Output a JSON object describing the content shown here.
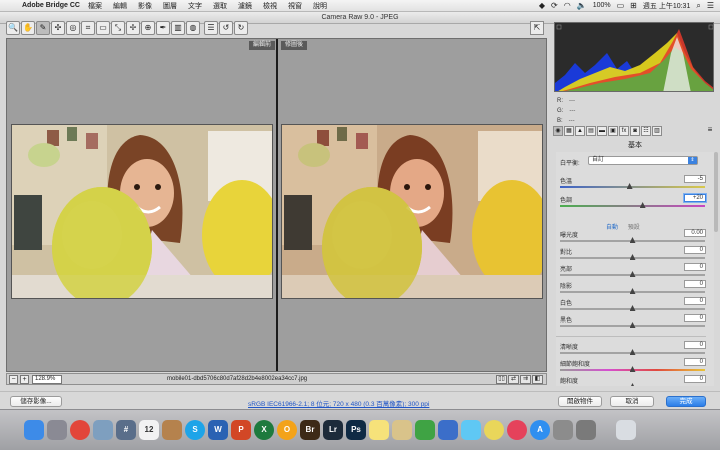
{
  "menubar": {
    "app_name": "Adobe Bridge CC",
    "items": [
      "檔案",
      "編輯",
      "影像",
      "圖層",
      "文字",
      "選取",
      "濾鏡",
      "檢視",
      "視窗",
      "說明"
    ],
    "battery": "100%",
    "clock": "週五 上午10:31"
  },
  "window": {
    "title": "Camera Raw 9.0  -  JPEG"
  },
  "toolbar": {
    "tools": [
      {
        "name": "zoom-tool",
        "glyph": "🔍"
      },
      {
        "name": "hand-tool",
        "glyph": "✋"
      },
      {
        "name": "white-balance-tool",
        "glyph": "✎"
      },
      {
        "name": "color-sampler-tool",
        "glyph": "✣"
      },
      {
        "name": "targeted-adjustment-tool",
        "glyph": "◎"
      },
      {
        "name": "crop-tool",
        "glyph": "⌗"
      },
      {
        "name": "straighten-tool",
        "glyph": "▭"
      },
      {
        "name": "transform-tool",
        "glyph": "⤡"
      },
      {
        "name": "spot-removal-tool",
        "glyph": "✢"
      },
      {
        "name": "red-eye-tool",
        "glyph": "⊕"
      },
      {
        "name": "adjustment-brush-tool",
        "glyph": "✒"
      },
      {
        "name": "graduated-filter-tool",
        "glyph": "▥"
      },
      {
        "name": "radial-filter-tool",
        "glyph": "◍"
      },
      {
        "name": "preferences-tool",
        "glyph": "☰"
      },
      {
        "name": "rotate-ccw-tool",
        "glyph": "↺"
      },
      {
        "name": "rotate-cw-tool",
        "glyph": "↻"
      }
    ]
  },
  "preview": {
    "before_label": "編輯前",
    "after_label": "修圖後"
  },
  "status": {
    "zoom": "128.9%",
    "filename": "mobile01-dbd5706c80d7af28d2b4e8002ea34cc7.jpg"
  },
  "histogram": {
    "r_label": "R:",
    "g_label": "G:",
    "b_label": "B:",
    "r_value": "---",
    "g_value": "---",
    "b_value": "---"
  },
  "panel": {
    "title": "基本",
    "wb_label": "白平衡:",
    "wb_value": "自訂",
    "temperature_label": "色溫",
    "temperature_value": "-5",
    "tint_label": "色調",
    "tint_value": "+20",
    "auto_label": "自動",
    "default_label": "預設",
    "sliders": [
      {
        "key": "exposure",
        "label": "曝光度",
        "value": "0.00",
        "pos": 0.5
      },
      {
        "key": "contrast",
        "label": "對比",
        "value": "0",
        "pos": 0.5
      },
      {
        "key": "highlights",
        "label": "亮部",
        "value": "0",
        "pos": 0.5
      },
      {
        "key": "shadows",
        "label": "陰影",
        "value": "0",
        "pos": 0.5
      },
      {
        "key": "whites",
        "label": "白色",
        "value": "0",
        "pos": 0.5
      },
      {
        "key": "blacks",
        "label": "黑色",
        "value": "0",
        "pos": 0.5
      },
      {
        "key": "clarity",
        "label": "清晰度",
        "value": "0",
        "pos": 0.5
      },
      {
        "key": "vibrance",
        "label": "細節飽和度",
        "value": "0",
        "pos": 0.5
      },
      {
        "key": "saturation",
        "label": "飽和度",
        "value": "0",
        "pos": 0.5
      }
    ],
    "temperature_pos": 0.48,
    "tint_pos": 0.57
  },
  "buttons": {
    "save": "儲存影像...",
    "workflow": "sRGB IEC61966-2.1; 8 位元; 720 x 480 (0.3 百萬像素); 300 ppi",
    "open": "開啟物件",
    "cancel": "取消",
    "done": "完成"
  },
  "dock": [
    {
      "name": "finder-icon",
      "label": "",
      "color": "#3d8be8"
    },
    {
      "name": "launchpad-icon",
      "label": "",
      "color": "#8a8a94"
    },
    {
      "name": "chrome-icon",
      "label": "",
      "color": "#e2463a"
    },
    {
      "name": "preview-icon",
      "label": "",
      "color": "#7e9fbf"
    },
    {
      "name": "textwrangler-icon",
      "label": "#",
      "color": "#5a6e8a"
    },
    {
      "name": "calendar-icon",
      "label": "12",
      "color": "#f2f2f2"
    },
    {
      "name": "contacts-icon",
      "label": "",
      "color": "#b5824d"
    },
    {
      "name": "skype-icon",
      "label": "S",
      "color": "#1ea4e8"
    },
    {
      "name": "word-icon",
      "label": "W",
      "color": "#2a62b3"
    },
    {
      "name": "powerpoint-icon",
      "label": "P",
      "color": "#d24726"
    },
    {
      "name": "excel-icon",
      "label": "X",
      "color": "#1e7a3e"
    },
    {
      "name": "outlook-icon",
      "label": "O",
      "color": "#f3a31a"
    },
    {
      "name": "bridge-icon",
      "label": "Br",
      "color": "#3d2a17"
    },
    {
      "name": "lightroom-icon",
      "label": "Lr",
      "color": "#1d2b3a"
    },
    {
      "name": "photoshop-icon",
      "label": "Ps",
      "color": "#0f2a44"
    },
    {
      "name": "notes-icon",
      "label": "",
      "color": "#f6e27a"
    },
    {
      "name": "stickies-icon",
      "label": "",
      "color": "#d9c38a"
    },
    {
      "name": "numbers-icon",
      "label": "",
      "color": "#3fa344"
    },
    {
      "name": "keynote-icon",
      "label": "",
      "color": "#3b6ec9"
    },
    {
      "name": "messages-icon",
      "label": "",
      "color": "#5fc8f4"
    },
    {
      "name": "photos-icon",
      "label": "",
      "color": "#e9d65a"
    },
    {
      "name": "itunes-icon",
      "label": "",
      "color": "#e5425b"
    },
    {
      "name": "app-store-icon",
      "label": "A",
      "color": "#2f8ff0"
    },
    {
      "name": "terminal-icon",
      "label": "",
      "color": "#8c8c8c"
    },
    {
      "name": "system-preferences-icon",
      "label": "",
      "color": "#7a7a7a"
    },
    {
      "name": "trash-icon",
      "label": "",
      "color": "#d9dde2"
    }
  ]
}
